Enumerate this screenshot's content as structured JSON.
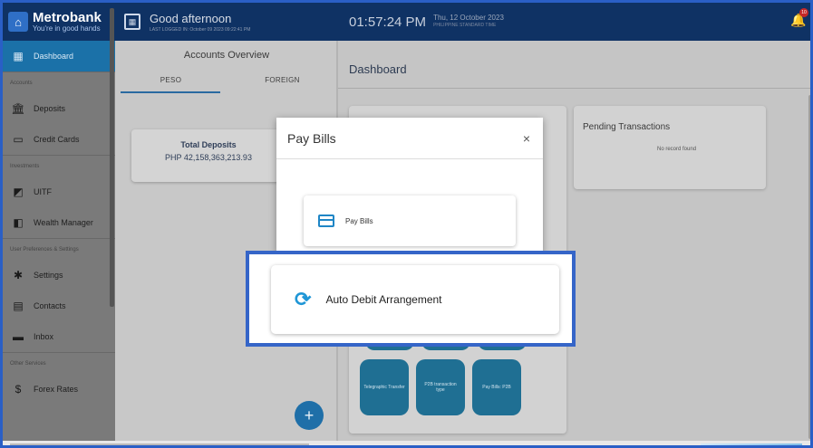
{
  "brand": {
    "name": "Metrobank",
    "tagline": "You're in good hands"
  },
  "sidebar": {
    "items": [
      {
        "type": "item",
        "label": "Dashboard",
        "icon": "dashboard-icon",
        "active": true
      },
      {
        "type": "section",
        "label": "Accounts"
      },
      {
        "type": "item",
        "label": "Deposits",
        "icon": "bank-icon"
      },
      {
        "type": "item",
        "label": "Credit Cards",
        "icon": "credit-card-icon"
      },
      {
        "type": "section",
        "label": "Investments"
      },
      {
        "type": "item",
        "label": "UITF",
        "icon": "uitf-icon"
      },
      {
        "type": "item",
        "label": "Wealth Manager",
        "icon": "wealth-manager-icon"
      },
      {
        "type": "section",
        "label": "User Preferences & Settings"
      },
      {
        "type": "item",
        "label": "Settings",
        "icon": "gear-icon"
      },
      {
        "type": "item",
        "label": "Contacts",
        "icon": "contacts-icon"
      },
      {
        "type": "item",
        "label": "Inbox",
        "icon": "inbox-icon"
      },
      {
        "type": "section",
        "label": "Other Services"
      },
      {
        "type": "item",
        "label": "Forex Rates",
        "icon": "forex-icon"
      }
    ]
  },
  "header": {
    "greeting": "Good afternoon",
    "last_logged": "LAST LOGGED IN: October 09 2023 09:22:41 PM",
    "time": "01:57:24 PM",
    "date": "Thu, 12 October 2023",
    "timezone": "PHILIPPINE STANDARD TIME",
    "notification_count": "10"
  },
  "accounts": {
    "title": "Accounts Overview",
    "tabs": [
      "PESO",
      "FOREIGN"
    ],
    "total_label": "Total Deposits",
    "total_value": "PHP 42,158,363,213.93"
  },
  "main": {
    "title": "Dashboard",
    "pending_title": "Pending Transactions",
    "pending_empty": "No record found",
    "tiles": [
      "Telegraphic Transfer",
      "P2B transaction type",
      "Pay Bills: P2B"
    ]
  },
  "modal": {
    "title": "Pay Bills",
    "close": "×",
    "option1": "Pay Bills",
    "option2": "Auto Debit Arrangement"
  },
  "colors": {
    "navy": "#0f3264",
    "accent": "#1f86c6",
    "highlight": "#3565c8"
  }
}
